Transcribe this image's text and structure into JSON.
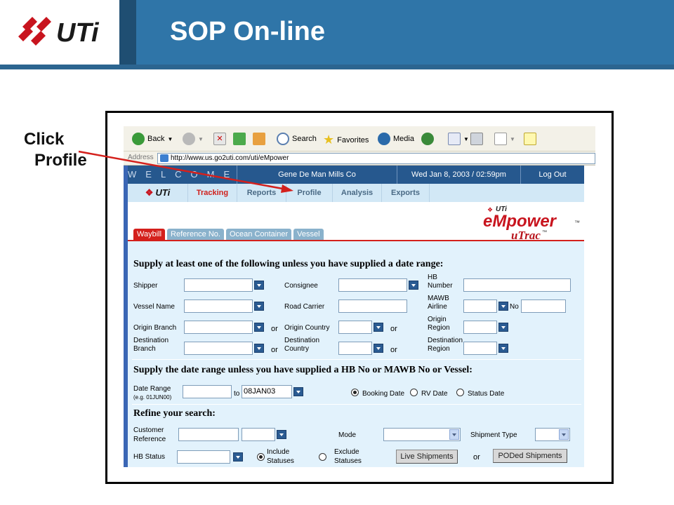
{
  "slide": {
    "title": "SOP On-line",
    "logo_text": "UTi",
    "callout_line1": "Click",
    "callout_line2": "Profile"
  },
  "colors": {
    "header": "#2f75a8",
    "accent": "#d4201c",
    "nav_bg": "#d2e8f6",
    "form_bg": "#e2f2fc",
    "welcome_bg": "#26588e"
  },
  "browser": {
    "back_label": "Back",
    "search_label": "Search",
    "favorites_label": "Favorites",
    "media_label": "Media",
    "address_label": "Address",
    "url": "http://www.us.go2uti.com/uti/eMpower"
  },
  "app": {
    "welcome": "WELCOME",
    "user": "Gene De Man Mills Co",
    "datetime": "Wed Jan 8, 2003 / 02:59pm",
    "logout": "Log Out",
    "nav_logo": "UTi",
    "nav": [
      "Tracking",
      "Reports",
      "Profile",
      "Analysis",
      "Exports"
    ],
    "brand_uti": "UTi",
    "brand_main": "eMpower",
    "brand_sub": "uTrac",
    "tm": "™",
    "tabs": [
      "Waybill",
      "Reference No.",
      "Ocean Container",
      "Vessel"
    ]
  },
  "form": {
    "section1": "Supply at least one of the following unless you have supplied a date range:",
    "section2": "Supply the date range unless you have supplied a HB No or MAWB No or Vessel:",
    "section3": "Refine your search:",
    "or": "or",
    "no": "No",
    "labels": {
      "shipper": "Shipper",
      "consignee": "Consignee",
      "hb_number_1": "HB",
      "hb_number_2": "Number",
      "vessel_name": "Vessel Name",
      "road_carrier": "Road Carrier",
      "mawb_1": "MAWB",
      "mawb_2": "Airline",
      "origin_branch": "Origin Branch",
      "origin_country": "Origin Country",
      "origin_region_1": "Origin",
      "origin_region_2": "Region",
      "dest_branch_1": "Destination",
      "dest_branch_2": "Branch",
      "dest_country_1": "Destination",
      "dest_country_2": "Country",
      "dest_region_1": "Destination",
      "dest_region_2": "Region",
      "date_range": "Date Range",
      "date_example": "(e.g. 01JUN00)",
      "to": "to",
      "booking_date": "Booking Date",
      "rv_date": "RV Date",
      "status_date": "Status Date",
      "cust_ref_1": "Customer",
      "cust_ref_2": "Reference",
      "mode": "Mode",
      "shipment_type": "Shipment Type",
      "hb_status": "HB Status",
      "include_1": "Include",
      "include_2": "Statuses",
      "exclude_1": "Exclude",
      "exclude_2": "Statuses"
    },
    "date_to_value": "08JAN03",
    "live_shipments": "Live Shipments",
    "poded_shipments": "PODed Shipments"
  }
}
